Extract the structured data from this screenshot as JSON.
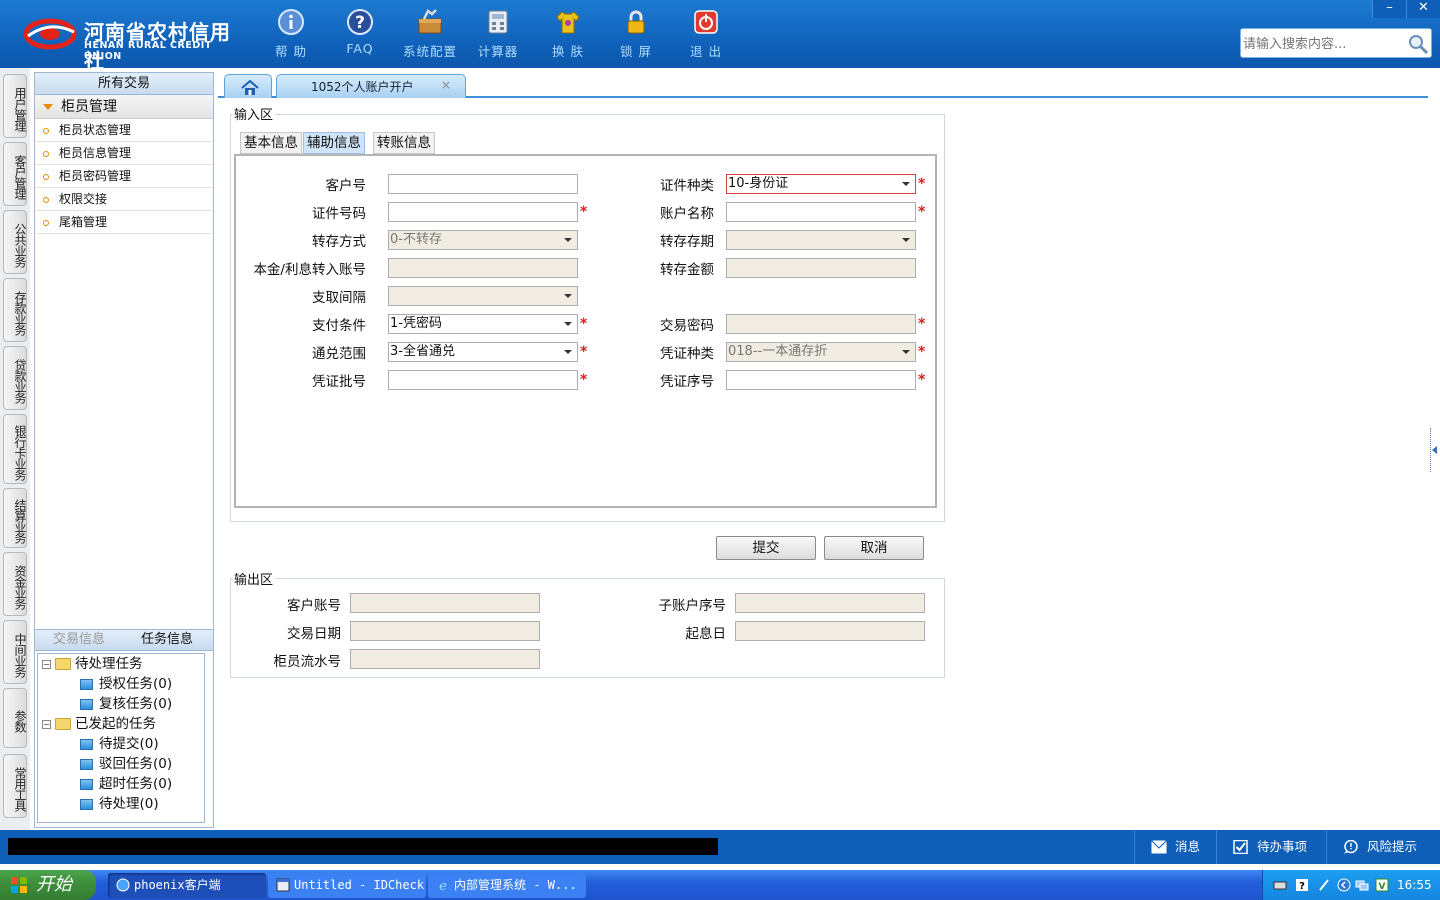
{
  "header": {
    "logo_cn": "河南省农村信用社",
    "logo_en": "HENAN RURAL CREDIT UNION",
    "tools": [
      "帮 助",
      "FAQ",
      "系统配置",
      "计算器",
      "换 肤",
      "锁 屏",
      "退 出"
    ],
    "search_placeholder": "请输入搜索内容...",
    "window_min": "–",
    "window_close": "✕"
  },
  "side_tabs": [
    "用户管理",
    "客户管理",
    "公共业务",
    "存款业务",
    "贷款业务",
    "银行卡业务",
    "结算业务",
    "资金业务",
    "中间业务",
    "参数",
    "常用工具"
  ],
  "left_panel": {
    "title": "所有交易",
    "group": "柜员管理",
    "items": [
      "柜员状态管理",
      "柜员信息管理",
      "柜员密码管理",
      "权限交接",
      "尾箱管理"
    ],
    "bottom_tabs": [
      "交易信息",
      "任务信息"
    ],
    "tree": {
      "pending": "待处理任务",
      "pending_items": [
        "授权任务(0)",
        "复核任务(0)"
      ],
      "initiated": "已发起的任务",
      "initiated_items": [
        "待提交(0)",
        "驳回任务(0)",
        "超时任务(0)",
        "待处理(0)"
      ]
    }
  },
  "tabs": {
    "active": "1052个人账户开户",
    "close": "×"
  },
  "input_area": {
    "label": "输入区",
    "sub_tabs": [
      "基本信息",
      "辅助信息",
      "转账信息"
    ],
    "fields": {
      "customer_no": {
        "label": "客户号",
        "value": ""
      },
      "id_type": {
        "label": "证件种类",
        "value": "10-身份证"
      },
      "id_no": {
        "label": "证件号码",
        "value": ""
      },
      "account_name": {
        "label": "账户名称",
        "value": ""
      },
      "transfer_mode": {
        "label": "转存方式",
        "value": "0-不转存"
      },
      "transfer_period": {
        "label": "转存存期",
        "value": ""
      },
      "interest_account": {
        "label": "本金/利息转入账号",
        "value": ""
      },
      "transfer_amount": {
        "label": "转存金额",
        "value": ""
      },
      "withdraw_interval": {
        "label": "支取间隔",
        "value": ""
      },
      "pay_condition": {
        "label": "支付条件",
        "value": "1-凭密码"
      },
      "trade_password": {
        "label": "交易密码",
        "value": ""
      },
      "exchange_scope": {
        "label": "通兑范围",
        "value": "3-全省通兑"
      },
      "voucher_type": {
        "label": "凭证种类",
        "value": "018--一本通存折"
      },
      "voucher_batch": {
        "label": "凭证批号",
        "value": ""
      },
      "voucher_serial": {
        "label": "凭证序号",
        "value": ""
      }
    },
    "required_mark": "*"
  },
  "buttons": {
    "submit": "提交",
    "cancel": "取消"
  },
  "output_area": {
    "label": "输出区",
    "fields": {
      "customer_account": {
        "label": "客户账号",
        "value": ""
      },
      "sub_account_seq": {
        "label": "子账户序号",
        "value": ""
      },
      "trade_date": {
        "label": "交易日期",
        "value": ""
      },
      "value_date": {
        "label": "起息日",
        "value": ""
      },
      "teller_serial": {
        "label": "柜员流水号",
        "value": ""
      }
    }
  },
  "status_bar": {
    "message": "消息",
    "todo": "待办事项",
    "risk": "风险提示"
  },
  "taskbar": {
    "start": "开始",
    "tasks": [
      "phoenix客户端",
      "Untitled - IDCheck",
      "内部管理系统 - W..."
    ],
    "clock": "16:55"
  },
  "colors": {
    "header_blue": "#1066c0",
    "required_red": "#d41e1e",
    "disabled_fill": "#f0ece2"
  }
}
